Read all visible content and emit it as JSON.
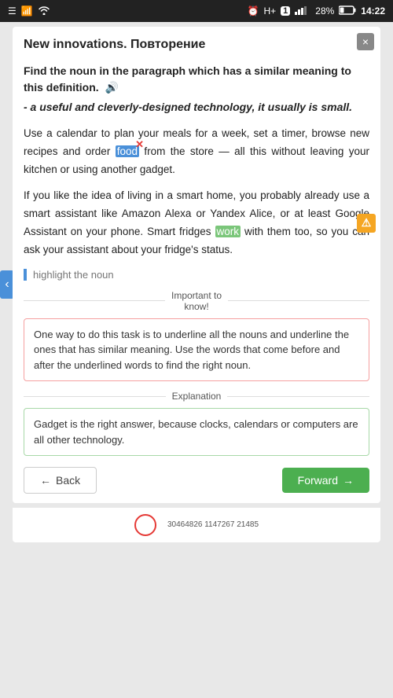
{
  "statusBar": {
    "left": {
      "simIcon": "☰",
      "wifiIcon": "wifi",
      "signalIcon": "signal"
    },
    "right": {
      "alarmIcon": "⏰",
      "networkLabel": "H+",
      "simNum": "1",
      "signalBars": "▂▄▆",
      "batteryLabel": "28%",
      "time": "14:22"
    }
  },
  "card": {
    "title": "New innovations. Повторение",
    "closeLabel": "×",
    "navArrow": "‹",
    "questionLabel": "Find the noun in the paragraph which has a similar meaning to this definition.",
    "audioIcon": "🔊",
    "definition": "- a useful and cleverly-designed technology, it usually is small.",
    "paragraph1": {
      "before1": "Use a calendar to plan your meals for a week, set a timer, browse new recipes and order ",
      "highlight1": "food",
      "between": " from the store — all this without leaving your kitchen or using another gadget.",
      "after": ""
    },
    "paragraph2": {
      "text1": "If you like the idea of living in a smart home, you probably already use a smart assistant like Amazon Alexa or Yandex Alice, or at least Google Assistant on your phone. Smart fridges ",
      "highlight2": "work",
      "text2": " with them too, so you can ask your assistant about your fridge's status."
    },
    "inputPlaceholder": "highlight the noun",
    "warningIcon": "⚠",
    "importantLabel": "Important to\nknow!",
    "infoText": "One way to do this task is to underline all the nouns and underline the ones that has similar meaning. Use the words that come before and after the underlined words to find the right noun.",
    "explanationLabel": "Explanation",
    "explanationText": "Gadget is the right answer, because clocks, calendars or computers are all other technology.",
    "backLabel": "Back",
    "forwardLabel": "Forward",
    "bottomNums": "30464826\n1147267\n21485"
  }
}
